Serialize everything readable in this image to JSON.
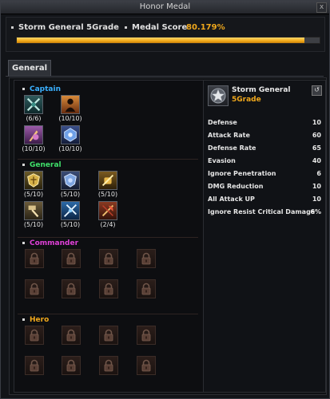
{
  "window": {
    "title": "Honor Medal",
    "close_glyph": "x"
  },
  "header": {
    "rank_label": "Storm General 5Grade",
    "score_label": "Medal Score",
    "score_value": "80.179%",
    "progress": 0.95
  },
  "tabs": [
    {
      "label": "General",
      "active": true
    }
  ],
  "sections": {
    "captain": {
      "title": "Captain",
      "color": "#3ab0ff",
      "slots": [
        {
          "icon": "crossed-swords-icon",
          "count": "(6/6)"
        },
        {
          "icon": "silhouette-icon",
          "count": "(10/10)"
        },
        {
          "icon": "warrior-icon",
          "count": "(10/10)"
        },
        {
          "icon": "blue-crest-icon",
          "count": "(10/10)"
        }
      ]
    },
    "general": {
      "title": "General",
      "color": "#3fe06a",
      "slots": [
        {
          "icon": "gold-shield-icon",
          "count": "(5/10)"
        },
        {
          "icon": "blue-shield-icon",
          "count": "(5/10)"
        },
        {
          "icon": "gold-fist-icon",
          "count": "(5/10)"
        },
        {
          "icon": "hammer-icon",
          "count": "(5/10)"
        },
        {
          "icon": "blue-blades-icon",
          "count": "(5/10)"
        },
        {
          "icon": "red-axe-icon",
          "count": "(2/4)"
        }
      ]
    },
    "commander": {
      "title": "Commander",
      "color": "#e040d8"
    },
    "hero": {
      "title": "Hero",
      "color": "#f0a81c"
    }
  },
  "medal": {
    "name": "Storm General",
    "grade": "5Grade",
    "refresh_glyph": "↺"
  },
  "stats": [
    {
      "name": "Defense",
      "value": "10"
    },
    {
      "name": "Attack Rate",
      "value": "60"
    },
    {
      "name": "Defense Rate",
      "value": "65"
    },
    {
      "name": "Evasion",
      "value": "40"
    },
    {
      "name": "Ignore Penetration",
      "value": "6"
    },
    {
      "name": "DMG Reduction",
      "value": "10"
    },
    {
      "name": "All Attack UP",
      "value": "10"
    },
    {
      "name": "Ignore Resist Critical Damage",
      "value": "6%"
    }
  ]
}
